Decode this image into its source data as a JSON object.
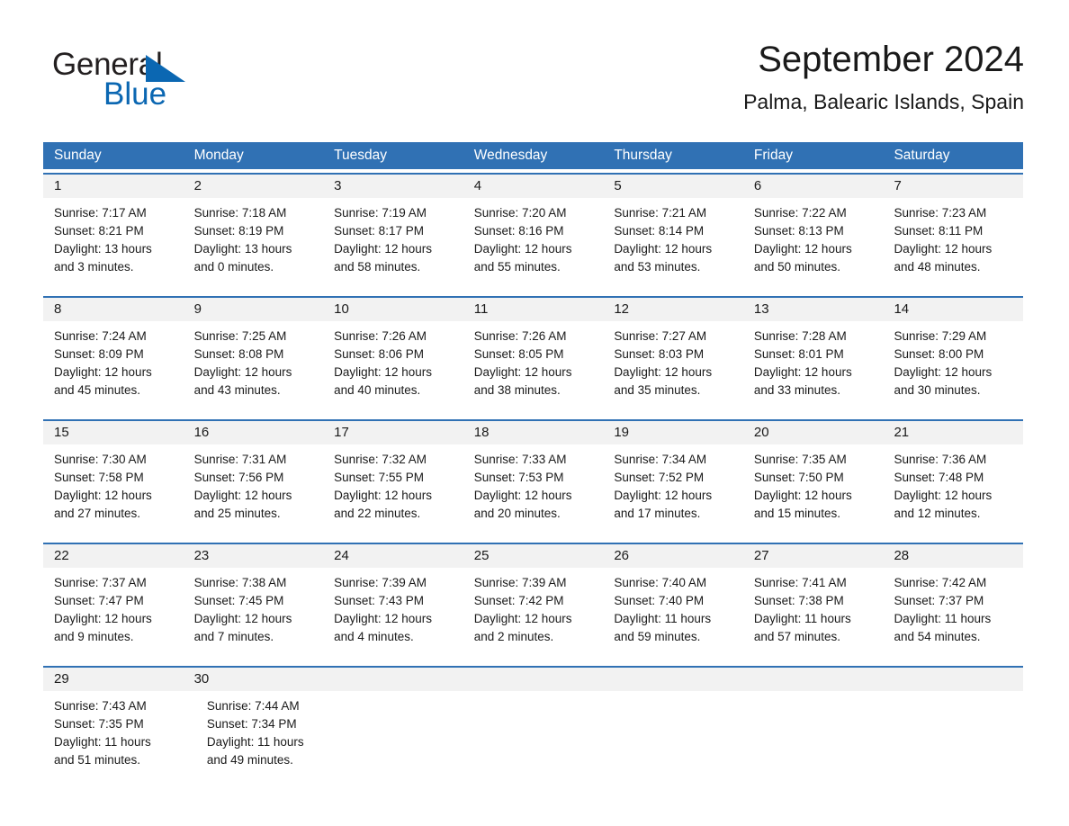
{
  "brand": {
    "name_part1": "General",
    "name_part2": "Blue",
    "accent_color": "#0b67b2"
  },
  "header": {
    "month_title": "September 2024",
    "location": "Palma, Balearic Islands, Spain"
  },
  "theme": {
    "header_blue": "#3071b4",
    "daynum_band": "#f2f2f2",
    "text": "#1a1a1a"
  },
  "weekdays": [
    "Sunday",
    "Monday",
    "Tuesday",
    "Wednesday",
    "Thursday",
    "Friday",
    "Saturday"
  ],
  "weeks": [
    {
      "days": [
        {
          "num": "1",
          "sunrise": "Sunrise: 7:17 AM",
          "sunset": "Sunset: 8:21 PM",
          "daylight1": "Daylight: 13 hours",
          "daylight2": "and 3 minutes."
        },
        {
          "num": "2",
          "sunrise": "Sunrise: 7:18 AM",
          "sunset": "Sunset: 8:19 PM",
          "daylight1": "Daylight: 13 hours",
          "daylight2": "and 0 minutes."
        },
        {
          "num": "3",
          "sunrise": "Sunrise: 7:19 AM",
          "sunset": "Sunset: 8:17 PM",
          "daylight1": "Daylight: 12 hours",
          "daylight2": "and 58 minutes."
        },
        {
          "num": "4",
          "sunrise": "Sunrise: 7:20 AM",
          "sunset": "Sunset: 8:16 PM",
          "daylight1": "Daylight: 12 hours",
          "daylight2": "and 55 minutes."
        },
        {
          "num": "5",
          "sunrise": "Sunrise: 7:21 AM",
          "sunset": "Sunset: 8:14 PM",
          "daylight1": "Daylight: 12 hours",
          "daylight2": "and 53 minutes."
        },
        {
          "num": "6",
          "sunrise": "Sunrise: 7:22 AM",
          "sunset": "Sunset: 8:13 PM",
          "daylight1": "Daylight: 12 hours",
          "daylight2": "and 50 minutes."
        },
        {
          "num": "7",
          "sunrise": "Sunrise: 7:23 AM",
          "sunset": "Sunset: 8:11 PM",
          "daylight1": "Daylight: 12 hours",
          "daylight2": "and 48 minutes."
        }
      ]
    },
    {
      "days": [
        {
          "num": "8",
          "sunrise": "Sunrise: 7:24 AM",
          "sunset": "Sunset: 8:09 PM",
          "daylight1": "Daylight: 12 hours",
          "daylight2": "and 45 minutes."
        },
        {
          "num": "9",
          "sunrise": "Sunrise: 7:25 AM",
          "sunset": "Sunset: 8:08 PM",
          "daylight1": "Daylight: 12 hours",
          "daylight2": "and 43 minutes."
        },
        {
          "num": "10",
          "sunrise": "Sunrise: 7:26 AM",
          "sunset": "Sunset: 8:06 PM",
          "daylight1": "Daylight: 12 hours",
          "daylight2": "and 40 minutes."
        },
        {
          "num": "11",
          "sunrise": "Sunrise: 7:26 AM",
          "sunset": "Sunset: 8:05 PM",
          "daylight1": "Daylight: 12 hours",
          "daylight2": "and 38 minutes."
        },
        {
          "num": "12",
          "sunrise": "Sunrise: 7:27 AM",
          "sunset": "Sunset: 8:03 PM",
          "daylight1": "Daylight: 12 hours",
          "daylight2": "and 35 minutes."
        },
        {
          "num": "13",
          "sunrise": "Sunrise: 7:28 AM",
          "sunset": "Sunset: 8:01 PM",
          "daylight1": "Daylight: 12 hours",
          "daylight2": "and 33 minutes."
        },
        {
          "num": "14",
          "sunrise": "Sunrise: 7:29 AM",
          "sunset": "Sunset: 8:00 PM",
          "daylight1": "Daylight: 12 hours",
          "daylight2": "and 30 minutes."
        }
      ]
    },
    {
      "days": [
        {
          "num": "15",
          "sunrise": "Sunrise: 7:30 AM",
          "sunset": "Sunset: 7:58 PM",
          "daylight1": "Daylight: 12 hours",
          "daylight2": "and 27 minutes."
        },
        {
          "num": "16",
          "sunrise": "Sunrise: 7:31 AM",
          "sunset": "Sunset: 7:56 PM",
          "daylight1": "Daylight: 12 hours",
          "daylight2": "and 25 minutes."
        },
        {
          "num": "17",
          "sunrise": "Sunrise: 7:32 AM",
          "sunset": "Sunset: 7:55 PM",
          "daylight1": "Daylight: 12 hours",
          "daylight2": "and 22 minutes."
        },
        {
          "num": "18",
          "sunrise": "Sunrise: 7:33 AM",
          "sunset": "Sunset: 7:53 PM",
          "daylight1": "Daylight: 12 hours",
          "daylight2": "and 20 minutes."
        },
        {
          "num": "19",
          "sunrise": "Sunrise: 7:34 AM",
          "sunset": "Sunset: 7:52 PM",
          "daylight1": "Daylight: 12 hours",
          "daylight2": "and 17 minutes."
        },
        {
          "num": "20",
          "sunrise": "Sunrise: 7:35 AM",
          "sunset": "Sunset: 7:50 PM",
          "daylight1": "Daylight: 12 hours",
          "daylight2": "and 15 minutes."
        },
        {
          "num": "21",
          "sunrise": "Sunrise: 7:36 AM",
          "sunset": "Sunset: 7:48 PM",
          "daylight1": "Daylight: 12 hours",
          "daylight2": "and 12 minutes."
        }
      ]
    },
    {
      "days": [
        {
          "num": "22",
          "sunrise": "Sunrise: 7:37 AM",
          "sunset": "Sunset: 7:47 PM",
          "daylight1": "Daylight: 12 hours",
          "daylight2": "and 9 minutes."
        },
        {
          "num": "23",
          "sunrise": "Sunrise: 7:38 AM",
          "sunset": "Sunset: 7:45 PM",
          "daylight1": "Daylight: 12 hours",
          "daylight2": "and 7 minutes."
        },
        {
          "num": "24",
          "sunrise": "Sunrise: 7:39 AM",
          "sunset": "Sunset: 7:43 PM",
          "daylight1": "Daylight: 12 hours",
          "daylight2": "and 4 minutes."
        },
        {
          "num": "25",
          "sunrise": "Sunrise: 7:39 AM",
          "sunset": "Sunset: 7:42 PM",
          "daylight1": "Daylight: 12 hours",
          "daylight2": "and 2 minutes."
        },
        {
          "num": "26",
          "sunrise": "Sunrise: 7:40 AM",
          "sunset": "Sunset: 7:40 PM",
          "daylight1": "Daylight: 11 hours",
          "daylight2": "and 59 minutes."
        },
        {
          "num": "27",
          "sunrise": "Sunrise: 7:41 AM",
          "sunset": "Sunset: 7:38 PM",
          "daylight1": "Daylight: 11 hours",
          "daylight2": "and 57 minutes."
        },
        {
          "num": "28",
          "sunrise": "Sunrise: 7:42 AM",
          "sunset": "Sunset: 7:37 PM",
          "daylight1": "Daylight: 11 hours",
          "daylight2": "and 54 minutes."
        }
      ]
    },
    {
      "days": [
        {
          "num": "29",
          "sunrise": "Sunrise: 7:43 AM",
          "sunset": "Sunset: 7:35 PM",
          "daylight1": "Daylight: 11 hours",
          "daylight2": "and 51 minutes."
        },
        {
          "num": "30",
          "sunrise": "Sunrise: 7:44 AM",
          "sunset": "Sunset: 7:34 PM",
          "daylight1": "Daylight: 11 hours",
          "daylight2": "and 49 minutes."
        },
        {
          "num": "",
          "sunrise": "",
          "sunset": "",
          "daylight1": "",
          "daylight2": ""
        },
        {
          "num": "",
          "sunrise": "",
          "sunset": "",
          "daylight1": "",
          "daylight2": ""
        },
        {
          "num": "",
          "sunrise": "",
          "sunset": "",
          "daylight1": "",
          "daylight2": ""
        },
        {
          "num": "",
          "sunrise": "",
          "sunset": "",
          "daylight1": "",
          "daylight2": ""
        },
        {
          "num": "",
          "sunrise": "",
          "sunset": "",
          "daylight1": "",
          "daylight2": ""
        }
      ]
    }
  ]
}
